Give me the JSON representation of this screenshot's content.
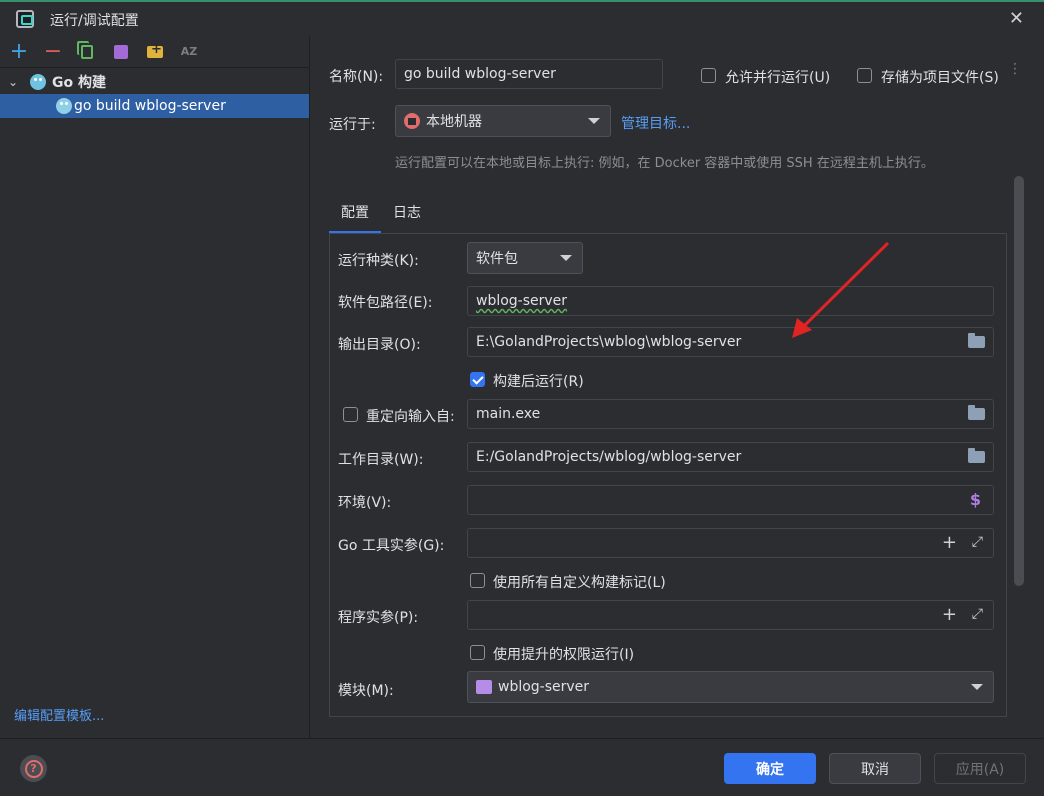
{
  "window": {
    "title": "运行/调试配置",
    "close_glyph": "✕"
  },
  "sidebar": {
    "toolbar": {
      "add_glyph": "+",
      "remove_glyph": "−",
      "sort_label": "AZ"
    },
    "group": {
      "label": "Go 构建",
      "chevron": "⌄"
    },
    "item": {
      "label": "go build wblog-server"
    },
    "edit_templates": "编辑配置模板..."
  },
  "header": {
    "name_label": "名称(N):",
    "name_value": "go build wblog-server",
    "allow_parallel": "允许并行运行(U)",
    "store_as_project": "存储为项目文件(S)",
    "run_on_label": "运行于:",
    "run_on_value": "本地机器",
    "manage_targets": "管理目标...",
    "hint": "运行配置可以在本地或目标上执行: 例如，在 Docker 容器中或使用 SSH 在远程主机上执行。"
  },
  "tabs": [
    {
      "label": "配置"
    },
    {
      "label": "日志"
    }
  ],
  "config": {
    "run_kind_label": "运行种类(K):",
    "run_kind_value": "软件包",
    "package_path_label": "软件包路径(E):",
    "package_path_value": "wblog-server",
    "output_dir_label": "输出目录(O):",
    "output_dir_value": "E:\\GolandProjects\\wblog\\wblog-server",
    "run_after_build": "构建后运行(R)",
    "redirect_input": "重定向输入自:",
    "redirect_value": "main.exe",
    "working_dir_label": "工作目录(W):",
    "working_dir_value": "E:/GolandProjects/wblog/wblog-server",
    "env_label": "环境(V):",
    "env_value": "",
    "go_tool_args_label": "Go 工具实参(G):",
    "use_all_build_tags": "使用所有自定义构建标记(L)",
    "program_args_label": "程序实参(P):",
    "use_elevated": "使用提升的权限运行(I)",
    "module_label": "模块(M):",
    "module_value": "wblog-server",
    "dollar_glyph": "$",
    "plus_glyph": "+",
    "expand_glyph": "⤢"
  },
  "footer": {
    "help_glyph": "?",
    "ok": "确定",
    "cancel": "取消",
    "apply": "应用(A)"
  },
  "colors": {
    "accent": "#3574f0",
    "link": "#589df6",
    "annotation_arrow": "#e02424"
  }
}
